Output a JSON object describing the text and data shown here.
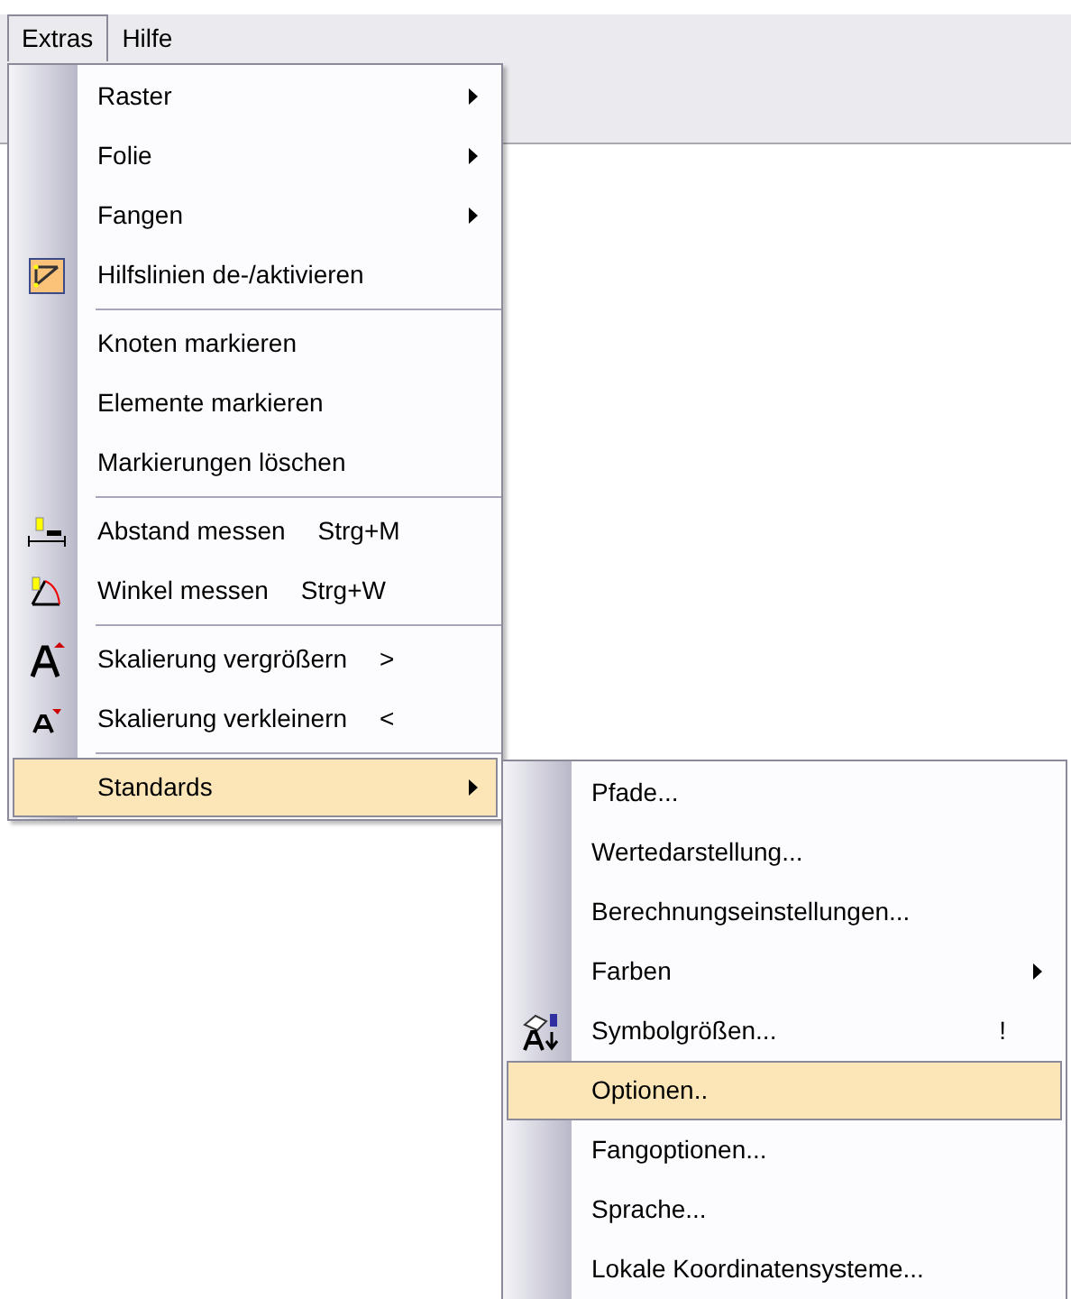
{
  "menubar": [
    {
      "label": "Extras",
      "selected": true
    },
    {
      "label": "Hilfe",
      "selected": false
    }
  ],
  "menu": {
    "items": [
      {
        "kind": "item",
        "label": "Raster",
        "submenu": true,
        "selected": false
      },
      {
        "kind": "item",
        "label": "Folie",
        "submenu": true,
        "selected": false
      },
      {
        "kind": "item",
        "label": "Fangen",
        "submenu": true,
        "selected": false
      },
      {
        "kind": "item",
        "label": "Hilfslinien de-/aktivieren",
        "checked": true,
        "selected": false
      },
      {
        "kind": "separator"
      },
      {
        "kind": "item",
        "label": "Knoten markieren",
        "selected": false
      },
      {
        "kind": "item",
        "label": "Elemente markieren",
        "selected": false
      },
      {
        "kind": "item",
        "label": "Markierungen löschen",
        "selected": false
      },
      {
        "kind": "separator"
      },
      {
        "kind": "item",
        "label": "Abstand messen",
        "shortcut": "Strg+M",
        "selected": false
      },
      {
        "kind": "item",
        "label": "Winkel messen",
        "shortcut": "Strg+W",
        "selected": false
      },
      {
        "kind": "separator"
      },
      {
        "kind": "item",
        "label": "Skalierung vergrößern",
        "shortcut": ">",
        "selected": false
      },
      {
        "kind": "item",
        "label": "Skalierung verkleinern",
        "shortcut": "<",
        "selected": false
      },
      {
        "kind": "separator"
      },
      {
        "kind": "item",
        "label": "Standards",
        "submenu": true,
        "selected": true
      }
    ]
  },
  "submenu": {
    "items": [
      {
        "kind": "item",
        "label": "Pfade...",
        "selected": false
      },
      {
        "kind": "item",
        "label": "Wertedarstellung...",
        "selected": false
      },
      {
        "kind": "item",
        "label": "Berechnungseinstellungen...",
        "selected": false
      },
      {
        "kind": "item",
        "label": "Farben",
        "submenu": true,
        "selected": false
      },
      {
        "kind": "item",
        "label": "Symbolgrößen...",
        "shortcut": "!",
        "selected": false
      },
      {
        "kind": "item",
        "label": "Optionen..",
        "selected": true
      },
      {
        "kind": "item",
        "label": "Fangoptionen...",
        "selected": false
      },
      {
        "kind": "item",
        "label": "Sprache...",
        "selected": false
      },
      {
        "kind": "item",
        "label": "Lokale Koordinatensysteme...",
        "selected": false
      }
    ]
  }
}
